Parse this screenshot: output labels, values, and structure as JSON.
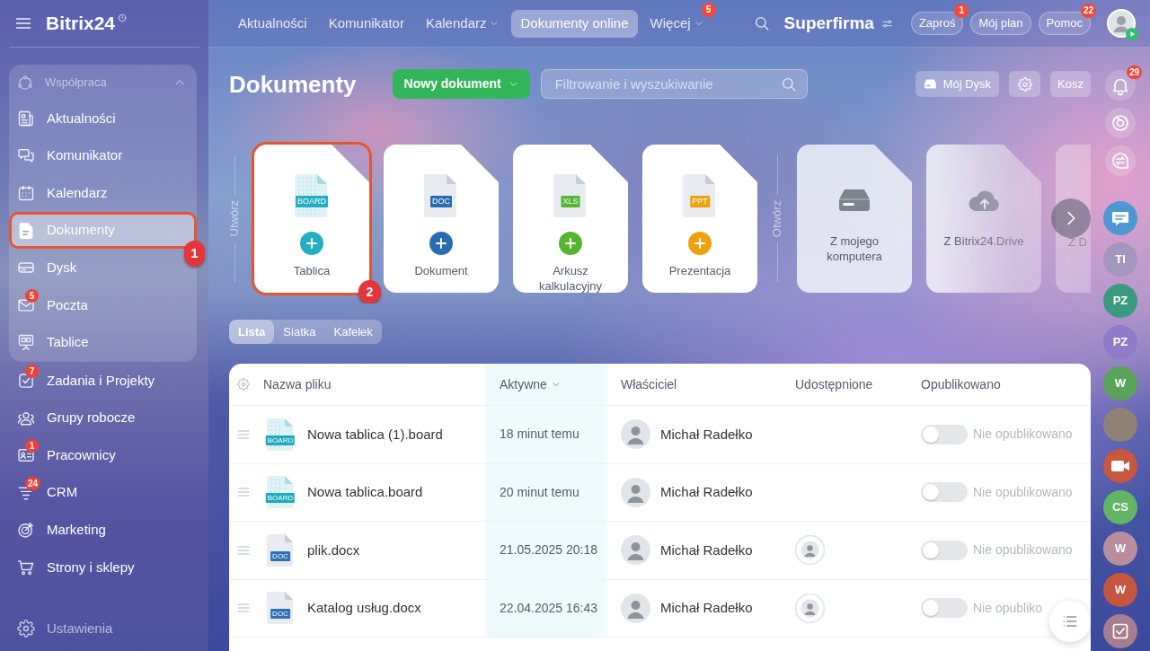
{
  "sidebar": {
    "logo": "Bitrix24",
    "group": {
      "title": "Współpraca",
      "expanded": true,
      "items": [
        {
          "label": "Aktualności",
          "selected": false
        },
        {
          "label": "Komunikator",
          "selected": false
        },
        {
          "label": "Kalendarz",
          "selected": false
        },
        {
          "label": "Dokumenty",
          "selected": true,
          "callout": "1"
        },
        {
          "label": "Dysk",
          "selected": false
        },
        {
          "label": "Poczta",
          "selected": false,
          "badge": "5"
        },
        {
          "label": "Tablice",
          "selected": false
        }
      ]
    },
    "items": [
      {
        "label": "Zadania i Projekty",
        "selected": false,
        "badge": "7"
      },
      {
        "label": "Grupy robocze",
        "selected": false
      },
      {
        "label": "Pracownicy",
        "selected": false,
        "badge": "1"
      },
      {
        "label": "CRM",
        "selected": false,
        "badge": "24"
      },
      {
        "label": "Marketing",
        "selected": false
      },
      {
        "label": "Strony i sklepy",
        "selected": false
      }
    ],
    "footer": "Ustawienia"
  },
  "top_nav": [
    {
      "label": "Aktualności",
      "selected": false,
      "dropdown": false
    },
    {
      "label": "Komunikator",
      "selected": false,
      "dropdown": false
    },
    {
      "label": "Kalendarz",
      "selected": false,
      "dropdown": true
    },
    {
      "label": "Dokumenty online",
      "selected": true,
      "dropdown": false
    },
    {
      "label": "Więcej",
      "selected": false,
      "dropdown": true,
      "badge": "5"
    }
  ],
  "header": {
    "company": "Superfirma",
    "buttons": [
      {
        "label": "Zaproś",
        "badge": "1"
      },
      {
        "label": "Mój plan"
      },
      {
        "label": "Pomoc",
        "badge": "22"
      }
    ]
  },
  "page": {
    "title": "Dokumenty",
    "new_button": "Nowy dokument",
    "search": {
      "placeholder": "Filtrowanie i wyszukiwanie"
    },
    "toolbar": [
      {
        "kind": "disk",
        "label": "Mój Dysk"
      },
      {
        "kind": "settings"
      },
      {
        "kind": "trash",
        "label": "Kosz"
      }
    ]
  },
  "create": {
    "label": "Utwórz",
    "cards": [
      {
        "label": "Tablica",
        "kind": "board",
        "tag": "BOARD",
        "color": "#24aec2",
        "callout": "2"
      },
      {
        "label": "Dokument",
        "kind": "doc",
        "tag": "DOC",
        "color": "#2b6cb0"
      },
      {
        "label": "Arkusz kalkulacyjny",
        "kind": "doc",
        "tag": "XLS",
        "color": "#55b530"
      },
      {
        "label": "Prezentacja",
        "kind": "doc",
        "tag": "PPT",
        "color": "#eea10c"
      }
    ]
  },
  "open": {
    "label": "Otwórz",
    "cards": [
      {
        "label": "Z mojego komputera",
        "kind": "computer"
      },
      {
        "label": "Z Bitrix24.Drive",
        "kind": "cloud"
      },
      {
        "label": "Z D",
        "kind": "partial"
      }
    ]
  },
  "view_tabs": [
    {
      "label": "Lista",
      "selected": true
    },
    {
      "label": "Siatka",
      "selected": false
    },
    {
      "label": "Kafelek",
      "selected": false
    }
  ],
  "table": {
    "columns": [
      {
        "label": "Nazwa pliku",
        "sorted": false
      },
      {
        "label": "Aktywne",
        "sorted": true
      },
      {
        "label": "Właściciel",
        "sorted": false
      },
      {
        "label": "Udostępnione",
        "sorted": false
      },
      {
        "label": "Opublikowano",
        "sorted": false
      }
    ],
    "rows": [
      {
        "name": "Nowa tablica (1).board",
        "kind": "board",
        "tag": "BOARD",
        "color": "#1eaabd",
        "activity": "18 minut temu",
        "owner": "Michał Radełko",
        "shared": false,
        "published": false,
        "status": "Nie opublikowano"
      },
      {
        "name": "Nowa tablica.board",
        "kind": "board",
        "tag": "BOARD",
        "color": "#1eaabd",
        "activity": "20 minut temu",
        "owner": "Michał Radełko",
        "shared": false,
        "published": false,
        "status": "Nie opublikowano"
      },
      {
        "name": "plik.docx",
        "kind": "doc",
        "tag": "DOC",
        "color": "#2d70b5",
        "activity": "21.05.2025 20:18",
        "owner": "Michał Radełko",
        "shared": true,
        "published": false,
        "status": "Nie opublikowano"
      },
      {
        "name": "Katalog usług.docx",
        "kind": "doc",
        "tag": "DOC",
        "color": "#2d70b5",
        "activity": "22.04.2025 16:43",
        "owner": "Michał Radełko",
        "shared": true,
        "published": false,
        "status": "Nie opubliko"
      }
    ]
  },
  "right_rail": {
    "notifications_badge": "29",
    "chats": [
      {
        "kind": "chat",
        "color": "#4f97d1"
      },
      {
        "kind": "initials",
        "initials": "TI",
        "color": "#a397c0"
      },
      {
        "kind": "initials",
        "initials": "PZ",
        "color": "#3a9a80"
      },
      {
        "kind": "initials",
        "initials": "PZ",
        "color": "#8f7bc8"
      },
      {
        "kind": "initials",
        "initials": "W",
        "color": "#5aa35a"
      },
      {
        "kind": "photo"
      },
      {
        "kind": "video",
        "color": "#c8573f"
      },
      {
        "kind": "initials",
        "initials": "CS",
        "color": "#62b565"
      },
      {
        "kind": "initials",
        "initials": "W",
        "color": "#b88d9e"
      },
      {
        "kind": "initials",
        "initials": "W",
        "color": "#c4553f"
      },
      {
        "kind": "task",
        "color": "#a77e8f"
      }
    ]
  }
}
